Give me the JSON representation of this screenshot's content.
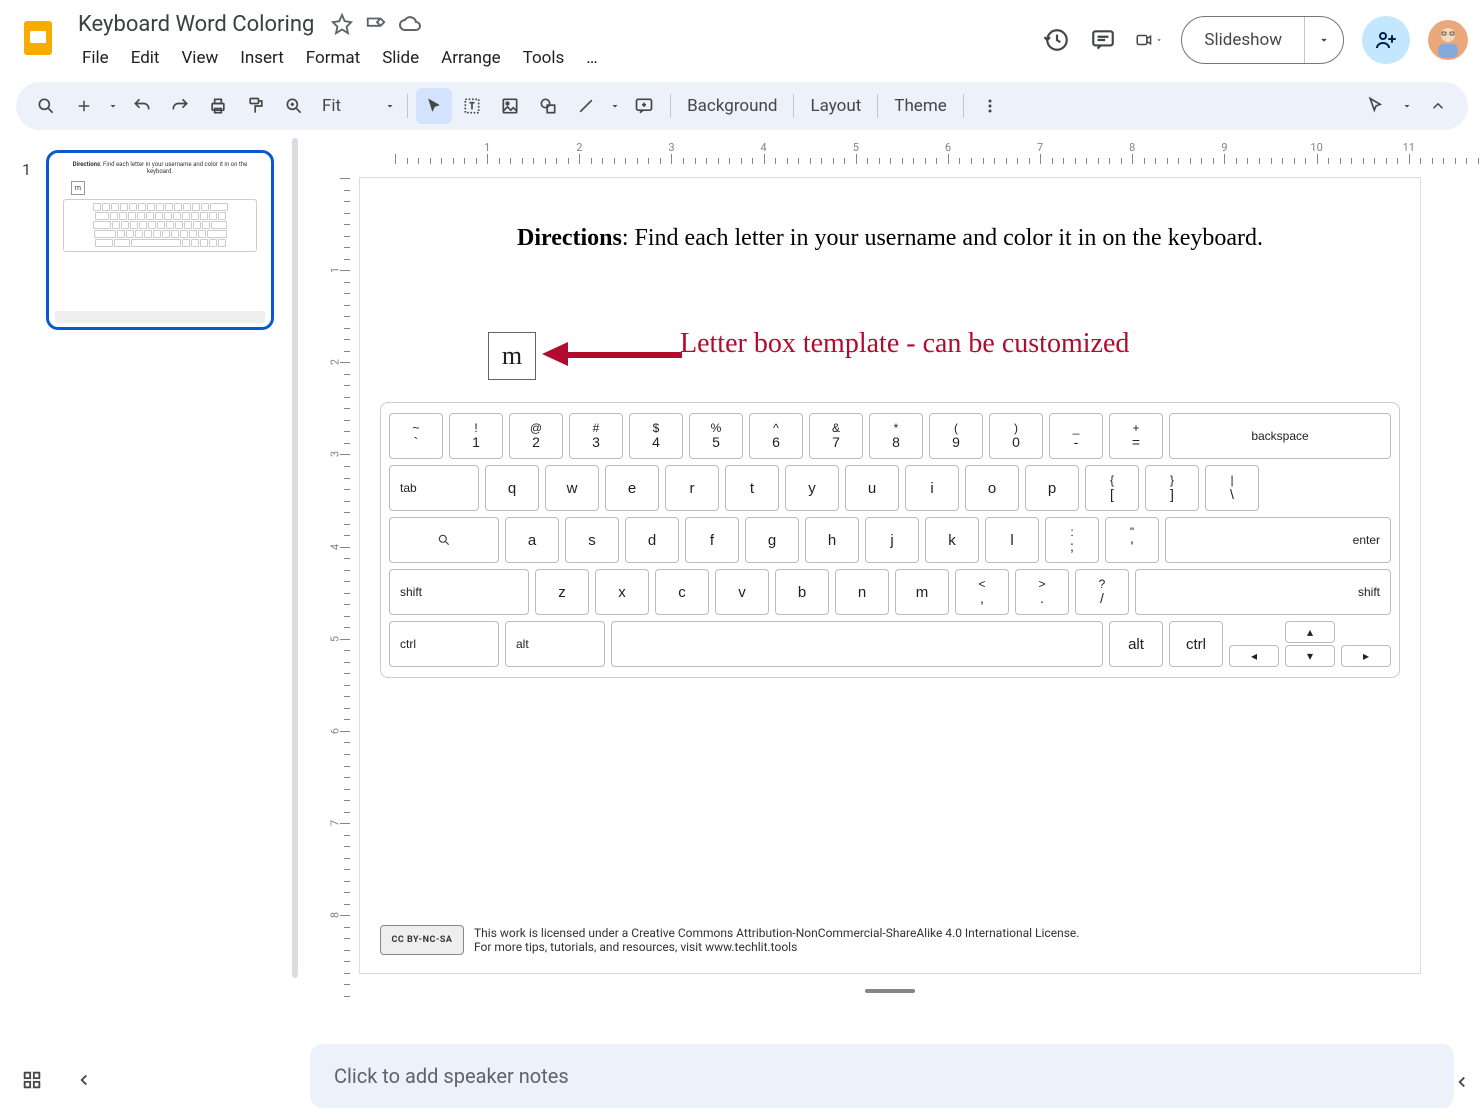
{
  "header": {
    "doc_title": "Keyboard Word Coloring",
    "menus": [
      "File",
      "Edit",
      "View",
      "Insert",
      "Format",
      "Slide",
      "Arrange",
      "Tools",
      "…"
    ],
    "slideshow_label": "Slideshow"
  },
  "toolbar": {
    "zoom_label": "Fit",
    "background_label": "Background",
    "layout_label": "Layout",
    "theme_label": "Theme"
  },
  "slidepanel": {
    "slide_number": "1"
  },
  "slide": {
    "directions_bold": "Directions",
    "directions_rest": ": Find each letter in your username and color it in on the keyboard.",
    "letter_box": "m",
    "annotation": "Letter box template - can be customized",
    "license_line1": "This work is licensed under a Creative Commons Attribution-NonCommercial-ShareAlike 4.0 International License.",
    "license_line2": "For more tips, tutorials, and resources, visit www.techlit.tools",
    "cc_badge": "CC BY-NC-SA",
    "keyboard": {
      "row1": [
        {
          "u": "~",
          "l": "`"
        },
        {
          "u": "!",
          "l": "1"
        },
        {
          "u": "@",
          "l": "2"
        },
        {
          "u": "#",
          "l": "3"
        },
        {
          "u": "$",
          "l": "4"
        },
        {
          "u": "%",
          "l": "5"
        },
        {
          "u": "^",
          "l": "6"
        },
        {
          "u": "&",
          "l": "7"
        },
        {
          "u": "*",
          "l": "8"
        },
        {
          "u": "(",
          "l": "9"
        },
        {
          "u": ")",
          "l": "0"
        },
        {
          "u": "_",
          "l": "-"
        },
        {
          "u": "+",
          "l": "="
        }
      ],
      "row1_end": "backspace",
      "row2_start": "tab",
      "row2": [
        "q",
        "w",
        "e",
        "r",
        "t",
        "y",
        "u",
        "i",
        "o",
        "p"
      ],
      "row2_end": [
        {
          "u": "{",
          "l": "["
        },
        {
          "u": "}",
          "l": "]"
        },
        {
          "u": "|",
          "l": "\\"
        }
      ],
      "row3": [
        "a",
        "s",
        "d",
        "f",
        "g",
        "h",
        "j",
        "k",
        "l"
      ],
      "row3_end": [
        {
          "u": ":",
          "l": ";"
        },
        {
          "u": "\"",
          "l": "'"
        }
      ],
      "row3_enter": "enter",
      "row4_start": "shift",
      "row4": [
        "z",
        "x",
        "c",
        "v",
        "b",
        "n",
        "m"
      ],
      "row4_end": [
        {
          "u": "<",
          "l": ","
        },
        {
          "u": ">",
          "l": "."
        },
        {
          "u": "?",
          "l": "/"
        }
      ],
      "row4_shift": "shift",
      "row5": {
        "ctrl": "ctrl",
        "alt": "alt"
      }
    }
  },
  "notes": {
    "placeholder": "Click to add speaker notes"
  }
}
